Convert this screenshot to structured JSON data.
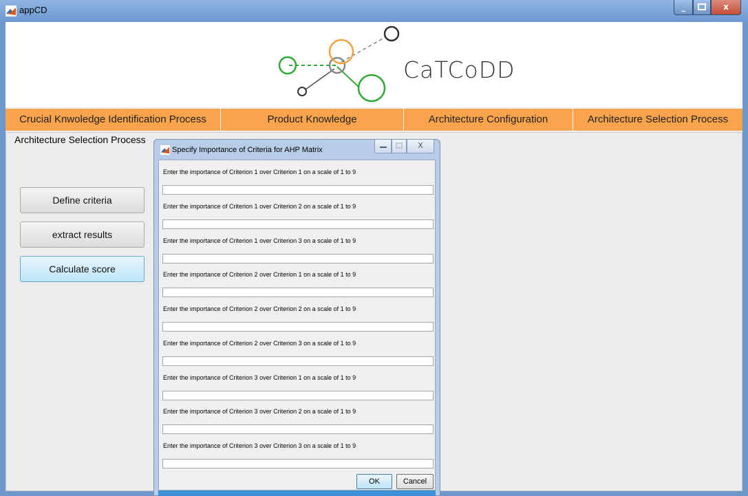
{
  "window": {
    "title": "appCD",
    "minimize": "_",
    "close": "x"
  },
  "banner": {
    "brand": "CaTCoDD"
  },
  "tabs": [
    {
      "label": "Crucial Knwoledge Identification Process"
    },
    {
      "label": "Product Knowledge"
    },
    {
      "label": "Architecture Configuration"
    },
    {
      "label": "Architecture Selection Process"
    }
  ],
  "panel": {
    "title": "Architecture Selection Process",
    "buttons": [
      {
        "label": "Define criteria"
      },
      {
        "label": "extract results"
      },
      {
        "label": "Calculate score"
      }
    ]
  },
  "dialog": {
    "title": "Specify Importance of Criteria for AHP Matrix",
    "close_label": "X",
    "prompts": [
      {
        "text": "Enter the importance of Criterion 1 over Criterion 1 on a scale of 1 to 9",
        "value": ""
      },
      {
        "text": "Enter the importance of Criterion 1 over Criterion 2 on a scale of 1 to 9",
        "value": ""
      },
      {
        "text": "Enter the importance of Criterion 1 over Criterion 3 on a scale of 1 to 9",
        "value": ""
      },
      {
        "text": "Enter the importance of Criterion 2 over Criterion 1 on a scale of 1 to 9",
        "value": ""
      },
      {
        "text": "Enter the importance of Criterion 2 over Criterion 2 on a scale of 1 to 9",
        "value": ""
      },
      {
        "text": "Enter the importance of Criterion 2 over Criterion 3 on a scale of 1 to 9",
        "value": ""
      },
      {
        "text": "Enter the importance of Criterion 3 over Criterion 1 on a scale of 1 to 9",
        "value": ""
      },
      {
        "text": "Enter the importance of Criterion 3 over Criterion 2 on a scale of 1 to 9",
        "value": ""
      },
      {
        "text": "Enter the importance of Criterion 3 over Criterion 3 on a scale of 1 to 9",
        "value": ""
      }
    ],
    "ok_label": "OK",
    "cancel_label": "Cancel"
  }
}
